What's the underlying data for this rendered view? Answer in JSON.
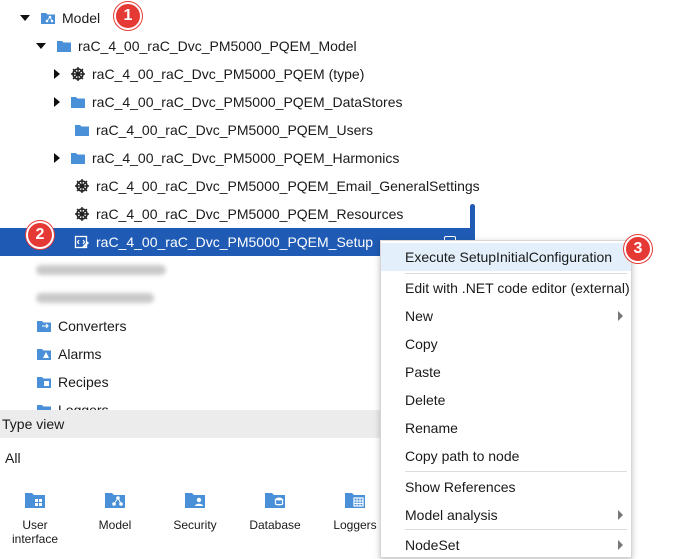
{
  "tree": {
    "items": [
      {
        "label": "Model",
        "icon": "model-folder-icon"
      },
      {
        "label": "raC_4_00_raC_Dvc_PM5000_PQEM_Model",
        "icon": "folder-icon"
      },
      {
        "label": "raC_4_00_raC_Dvc_PM5000_PQEM (type)",
        "icon": "object-type-icon"
      },
      {
        "label": "raC_4_00_raC_Dvc_PM5000_PQEM_DataStores",
        "icon": "folder-icon"
      },
      {
        "label": "raC_4_00_raC_Dvc_PM5000_PQEM_Users",
        "icon": "folder-icon"
      },
      {
        "label": "raC_4_00_raC_Dvc_PM5000_PQEM_Harmonics",
        "icon": "folder-icon"
      },
      {
        "label": "raC_4_00_raC_Dvc_PM5000_PQEM_Email_GeneralSettings",
        "icon": "object-type-icon"
      },
      {
        "label": "raC_4_00_raC_Dvc_PM5000_PQEM_Resources",
        "icon": "object-type-icon"
      },
      {
        "label": "raC_4_00_raC_Dvc_PM5000_PQEM_Setup",
        "icon": "netlogic-icon"
      },
      {
        "label": "Converters",
        "icon": "converters-folder-icon"
      },
      {
        "label": "Alarms",
        "icon": "alarms-folder-icon"
      },
      {
        "label": "Recipes",
        "icon": "recipes-folder-icon"
      },
      {
        "label": "Loggers",
        "icon": "loggers-folder-icon"
      }
    ]
  },
  "badges": [
    "1",
    "2",
    "3"
  ],
  "type_view": {
    "title": "Type view",
    "filter": "All",
    "items": [
      {
        "label": "User interface",
        "icon": "user-interface-icon"
      },
      {
        "label": "Model",
        "icon": "model-icon"
      },
      {
        "label": "Security",
        "icon": "security-icon"
      },
      {
        "label": "Database",
        "icon": "database-icon"
      },
      {
        "label": "Loggers",
        "icon": "loggers-icon"
      }
    ]
  },
  "context_menu": {
    "items": [
      {
        "label": "Execute SetupInitialConfiguration"
      },
      {
        "label": "Edit with .NET code editor (external)"
      },
      {
        "label": "New"
      },
      {
        "label": "Copy"
      },
      {
        "label": "Paste"
      },
      {
        "label": "Delete"
      },
      {
        "label": "Rename"
      },
      {
        "label": "Copy path to node"
      },
      {
        "label": "Show References"
      },
      {
        "label": "Model analysis"
      },
      {
        "label": "NodeSet"
      }
    ]
  },
  "colors": {
    "selection": "#1f5bb5",
    "folder": "#4a90d9",
    "badge": "#e53935",
    "menu_highlight": "#e3f0fb"
  }
}
